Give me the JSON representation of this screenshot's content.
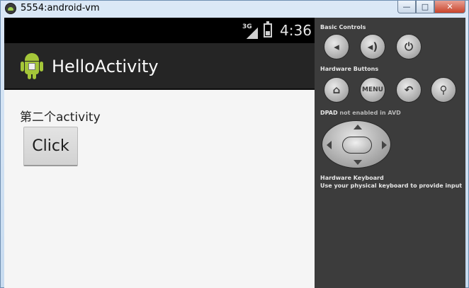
{
  "window": {
    "title": "5554:android-vm",
    "minimize_label": "—",
    "maximize_label": "□",
    "close_label": "✕"
  },
  "device": {
    "statusbar": {
      "network": "3G",
      "time": "4:36"
    },
    "actionbar": {
      "title": "HelloActivity"
    },
    "content": {
      "text": "第二个activity",
      "button_label": "Click"
    }
  },
  "controls": {
    "basic_title": "Basic Controls",
    "hardware_title": "Hardware Buttons",
    "dpad_title": "DPAD",
    "dpad_note": " not enabled in AVD",
    "keyboard_title": "Hardware Keyboard",
    "keyboard_note": "Use your physical keyboard to provide input",
    "basic_buttons": [
      {
        "icon": "volume-down-icon",
        "glyph": "◂"
      },
      {
        "icon": "volume-up-icon",
        "glyph": "◂)"
      },
      {
        "icon": "power-icon",
        "glyph": "⏻"
      }
    ],
    "hardware_buttons": [
      {
        "icon": "home-icon",
        "glyph": "⌂"
      },
      {
        "icon": "menu-icon",
        "label": "MENU"
      },
      {
        "icon": "back-icon",
        "glyph": "↶"
      },
      {
        "icon": "search-icon",
        "glyph": "⚲"
      }
    ]
  }
}
